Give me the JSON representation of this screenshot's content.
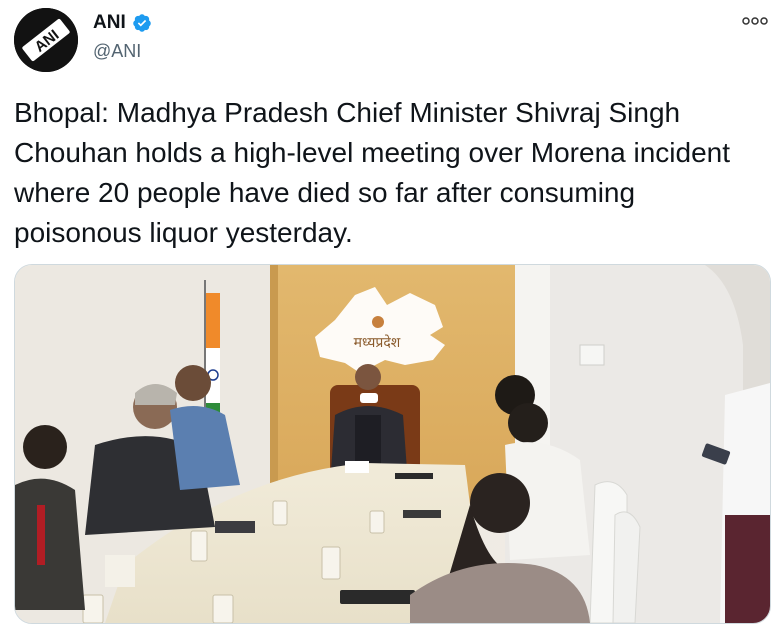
{
  "account": {
    "display_name": "ANI",
    "handle": "@ANI",
    "verified": true,
    "avatar_text": "ANI"
  },
  "tweet": {
    "text": "Bhopal: Madhya Pradesh Chief Minister Shivraj Singh Chouhan holds a high-level meeting over Morena incident where 20 people have died so far after consuming poisonous liquor yesterday."
  },
  "media": {
    "wall_sign_text": "मध्यप्रदेश"
  },
  "icons": {
    "verified": "verified-badge-icon",
    "more": "more-options-icon"
  },
  "colors": {
    "verified_blue": "#1d9bf0",
    "text": "#0f1419",
    "secondary_text": "#536471",
    "border": "#cfd9de"
  }
}
